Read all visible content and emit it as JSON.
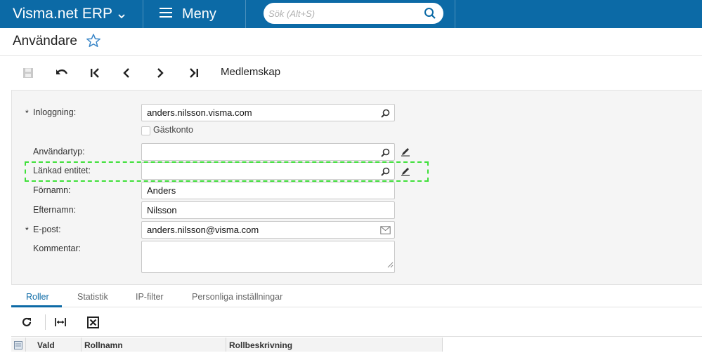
{
  "app": {
    "brand": "Visma.net ERP",
    "menu_label": "Meny",
    "search_placeholder": "Sök (Alt+S)",
    "accent_color": "#0c6aa6"
  },
  "page": {
    "title": "Användare"
  },
  "toolbar": {
    "buttons": [
      "save-icon",
      "undo-icon",
      "first-record-icon",
      "previous-record-icon",
      "next-record-icon",
      "last-record-icon"
    ],
    "membership_label": "Medlemskap"
  },
  "form": {
    "login": {
      "label": "Inloggning:",
      "required": "*",
      "value": "anders.nilsson.visma.com"
    },
    "guest_account": {
      "label": "Gästkonto",
      "checked": false
    },
    "user_type": {
      "label": "Användartyp:",
      "value": ""
    },
    "linked_entity": {
      "label": "Länkad entitet:",
      "value": ""
    },
    "first_name": {
      "label": "Förnamn:",
      "value": "Anders"
    },
    "last_name": {
      "label": "Efternamn:",
      "value": "Nilsson"
    },
    "email": {
      "label": "E-post:",
      "required": "*",
      "value": "anders.nilsson@visma.com"
    },
    "comment": {
      "label": "Kommentar:",
      "value": ""
    },
    "highlight_color": "#3fe03a"
  },
  "tabs": [
    {
      "label": "Roller",
      "active": true
    },
    {
      "label": "Statistik",
      "active": false
    },
    {
      "label": "IP-filter",
      "active": false
    },
    {
      "label": "Personliga inställningar",
      "active": false
    }
  ],
  "grid": {
    "toolbar": [
      "refresh-icon",
      "fit-columns-icon",
      "export-excel-icon"
    ],
    "columns": [
      "Vald",
      "Rollnamn",
      "Rollbeskrivning"
    ]
  }
}
